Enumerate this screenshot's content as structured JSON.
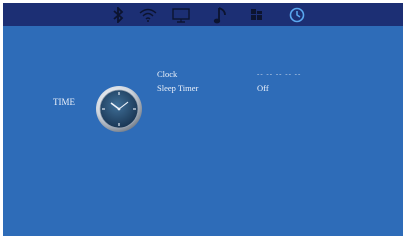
{
  "tabs": [
    {
      "icon": "bluetooth-icon",
      "active": false
    },
    {
      "icon": "wifi-icon",
      "active": false
    },
    {
      "icon": "monitor-icon",
      "active": false
    },
    {
      "icon": "music-note-icon",
      "active": false
    },
    {
      "icon": "grid-settings-icon",
      "active": false
    },
    {
      "icon": "clock-icon",
      "active": true
    }
  ],
  "section": {
    "title": "TIME"
  },
  "settings": [
    {
      "label": "Clock",
      "value": "-- -- --   -- --"
    },
    {
      "label": "Sleep Timer",
      "value": "Off"
    }
  ],
  "colors": {
    "background": "#2e6cb8",
    "topbar": "#1c2f74",
    "icon_idle": "#0c1430",
    "icon_active": "#5aa8f0",
    "text": "#eef3fb"
  }
}
